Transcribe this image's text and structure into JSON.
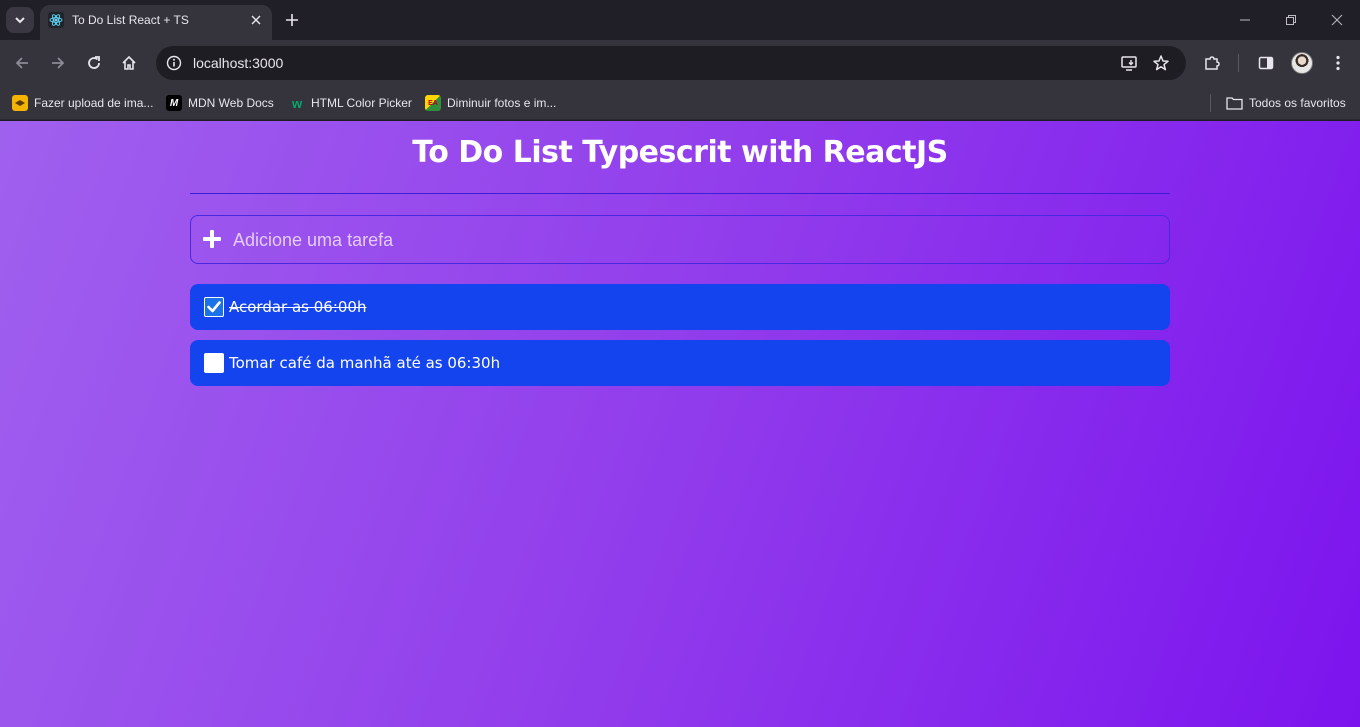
{
  "browser": {
    "tab": {
      "title": "To Do List React + TS",
      "favicon": "react-icon"
    },
    "address": "localhost:3000",
    "bookmarks": [
      {
        "label": "Fazer upload de ima...",
        "icon": "upload-icon",
        "color": "#f4b400"
      },
      {
        "label": "MDN Web Docs",
        "icon": "mdn-icon",
        "color": "#000000"
      },
      {
        "label": "HTML Color Picker",
        "icon": "w3schools-icon",
        "color": "#04aa6d"
      },
      {
        "label": "Diminuir fotos e im...",
        "icon": "easy-icon",
        "color": "#ffd600"
      }
    ],
    "all_bookmarks": "Todos os favoritos"
  },
  "app": {
    "title": "To Do List Typescrit with ReactJS",
    "input_placeholder": "Adicione uma tarefa",
    "tasks": [
      {
        "label": "Acordar as 06:00h",
        "done": true
      },
      {
        "label": "Tomar café da manhã até as 06:30h",
        "done": false
      }
    ]
  },
  "colors": {
    "background_start": "#a060ee",
    "background_end": "#7c14ee",
    "task_bg": "#1444ee",
    "border": "#4a28e0"
  }
}
